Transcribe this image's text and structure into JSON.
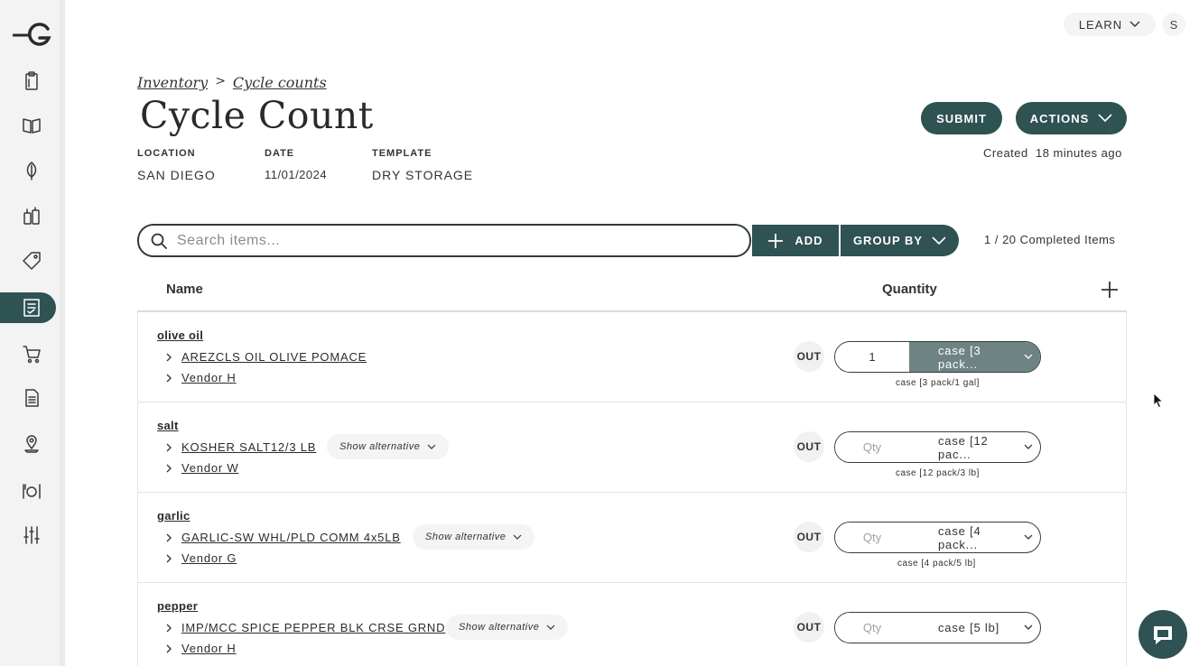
{
  "topbar": {
    "learn_label": "LEARN",
    "avatar_initial": "S"
  },
  "breadcrumb": {
    "items": [
      "Inventory",
      "Cycle counts"
    ],
    "separator": ">"
  },
  "page": {
    "title": "Cycle Count",
    "created_text": "Created  18 minutes ago"
  },
  "meta": {
    "location_label": "LOCATION",
    "location_value": "SAN DIEGO",
    "date_label": "DATE",
    "date_value": "11/01/2024",
    "template_label": "TEMPLATE",
    "template_value": "DRY STORAGE"
  },
  "actions": {
    "submit_label": "SUBMIT",
    "actions_label": "ACTIONS"
  },
  "toolbar": {
    "search_placeholder": "Search items...",
    "add_label": "ADD",
    "group_by_label": "GROUP BY",
    "completed_text": "1 / 20 Completed Items"
  },
  "table": {
    "col_name": "Name",
    "col_quantity": "Quantity",
    "out_label": "OUT",
    "alt_label": "Show alternative",
    "qty_placeholder": "Qty",
    "rows": [
      {
        "name": "olive oil",
        "product": "AREZCLS OIL OLIVE POMACE",
        "vendor": "Vendor H",
        "qty": "1",
        "unit": "case [3 pack...",
        "unit_full": "case [3 pack/1 gal]"
      },
      {
        "name": "salt",
        "product": "KOSHER SALT12/3 LB",
        "vendor": "Vendor W",
        "qty": "",
        "unit": "case [12 pac...",
        "unit_full": "case [12 pack/3 lb]"
      },
      {
        "name": "garlic",
        "product": "GARLIC-SW WHL/PLD COMM 4x5LB",
        "vendor": "Vendor G",
        "qty": "",
        "unit": "case [4 pack...",
        "unit_full": "case [4 pack/5 lb]"
      },
      {
        "name": "pepper",
        "product": "IMP/MCC SPICE PEPPER BLK CRSE GRND",
        "vendor": "Vendor H",
        "qty": "",
        "unit": "case [5 lb]",
        "unit_full": ""
      }
    ]
  },
  "colors": {
    "accent": "#2f5252",
    "unit_filled": "#6e8484",
    "sidebar_bg": "#f3f3f3"
  },
  "sidebar_icons": [
    "logo-icon",
    "clipboard-icon",
    "book-icon",
    "leaf-icon",
    "bottles-icon",
    "tag-icon",
    "checklist-icon",
    "cart-icon",
    "document-icon",
    "location-pin-icon",
    "dining-icon",
    "sliders-icon"
  ]
}
